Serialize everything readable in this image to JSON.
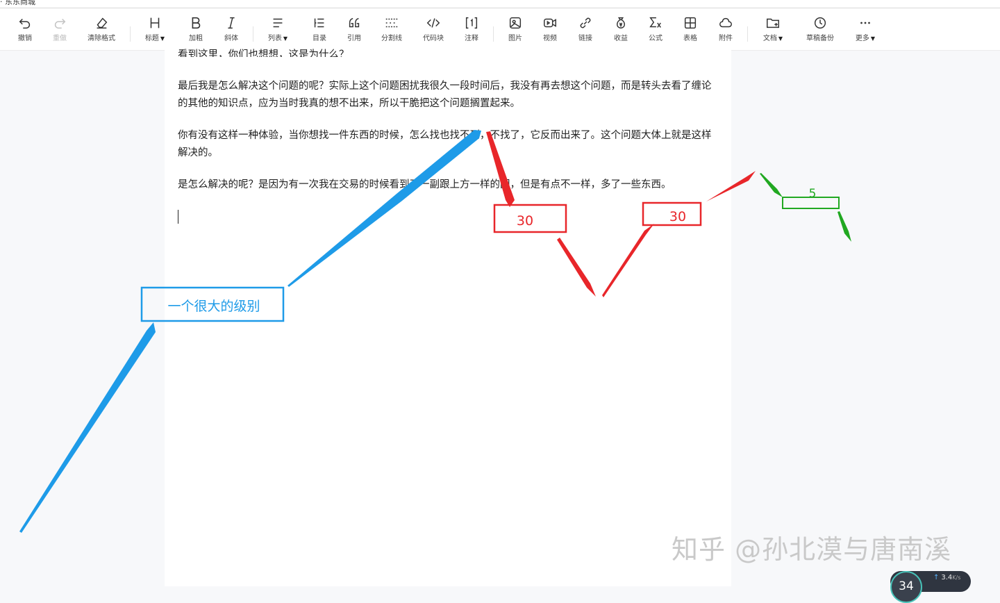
{
  "window": {
    "title": "· 东东商城"
  },
  "toolbar": {
    "items": [
      {
        "key": "undo",
        "label": "撤销",
        "icon": "undo-icon"
      },
      {
        "key": "redo",
        "label": "重做",
        "icon": "redo-icon",
        "disabled": true
      },
      {
        "key": "clear",
        "label": "清除格式",
        "icon": "eraser-icon"
      },
      {
        "key": "heading",
        "label": "标题",
        "icon": "heading-icon",
        "dropdown": true
      },
      {
        "key": "bold",
        "label": "加粗",
        "icon": "bold-icon"
      },
      {
        "key": "italic",
        "label": "斜体",
        "icon": "italic-icon"
      },
      {
        "key": "list",
        "label": "列表",
        "icon": "list-icon",
        "dropdown": true
      },
      {
        "key": "toc",
        "label": "目录",
        "icon": "toc-icon"
      },
      {
        "key": "quote",
        "label": "引用",
        "icon": "quote-icon"
      },
      {
        "key": "divider",
        "label": "分割线",
        "icon": "divider-icon"
      },
      {
        "key": "code",
        "label": "代码块",
        "icon": "code-icon"
      },
      {
        "key": "footnote",
        "label": "注释",
        "icon": "footnote-icon"
      },
      {
        "key": "image",
        "label": "图片",
        "icon": "image-icon"
      },
      {
        "key": "video",
        "label": "视频",
        "icon": "video-icon"
      },
      {
        "key": "link",
        "label": "链接",
        "icon": "link-icon"
      },
      {
        "key": "earn",
        "label": "收益",
        "icon": "money-bag-icon"
      },
      {
        "key": "formula",
        "label": "公式",
        "icon": "formula-icon"
      },
      {
        "key": "table",
        "label": "表格",
        "icon": "table-icon"
      },
      {
        "key": "attach",
        "label": "附件",
        "icon": "cloud-icon"
      },
      {
        "key": "doc",
        "label": "文档",
        "icon": "folder-add-icon",
        "dropdown": true
      },
      {
        "key": "draft",
        "label": "草稿备份",
        "icon": "clock-icon"
      },
      {
        "key": "more",
        "label": "更多",
        "icon": "more-icon",
        "dropdown": true
      }
    ]
  },
  "content": {
    "p0": "看到这里，你们也想想，这是为什么？",
    "p1": "最后我是怎么解决这个问题的呢？实际上这个问题困扰我很久一段时间后，我没有再去想这个问题，而是转头去看了缠论的其他的知识点，应为当时我真的想不出来，所以干脆把这个问题搁置起来。",
    "p2": "你有没有这样一种体验，当你想找一件东西的时候，怎么找也找不到，不找了，它反而出来了。这个问题大体上就是这样解决的。",
    "p3": "是怎么解决的呢？是因为有一次我在交易的时候看到了一副跟上方一样的图，但是有点不一样，多了一些东西。"
  },
  "annotations": {
    "blue_box": "一个很大的级别",
    "red_box_1": "30",
    "red_box_2": "30",
    "green_box": "5",
    "colors": {
      "blue": "#1e9be8",
      "red": "#e8262a",
      "green": "#21a821"
    }
  },
  "watermark": "知乎 @孙北漠与唐南溪",
  "speed_widget": {
    "percent": "34",
    "rate": "3.4",
    "unit": "K/s"
  }
}
